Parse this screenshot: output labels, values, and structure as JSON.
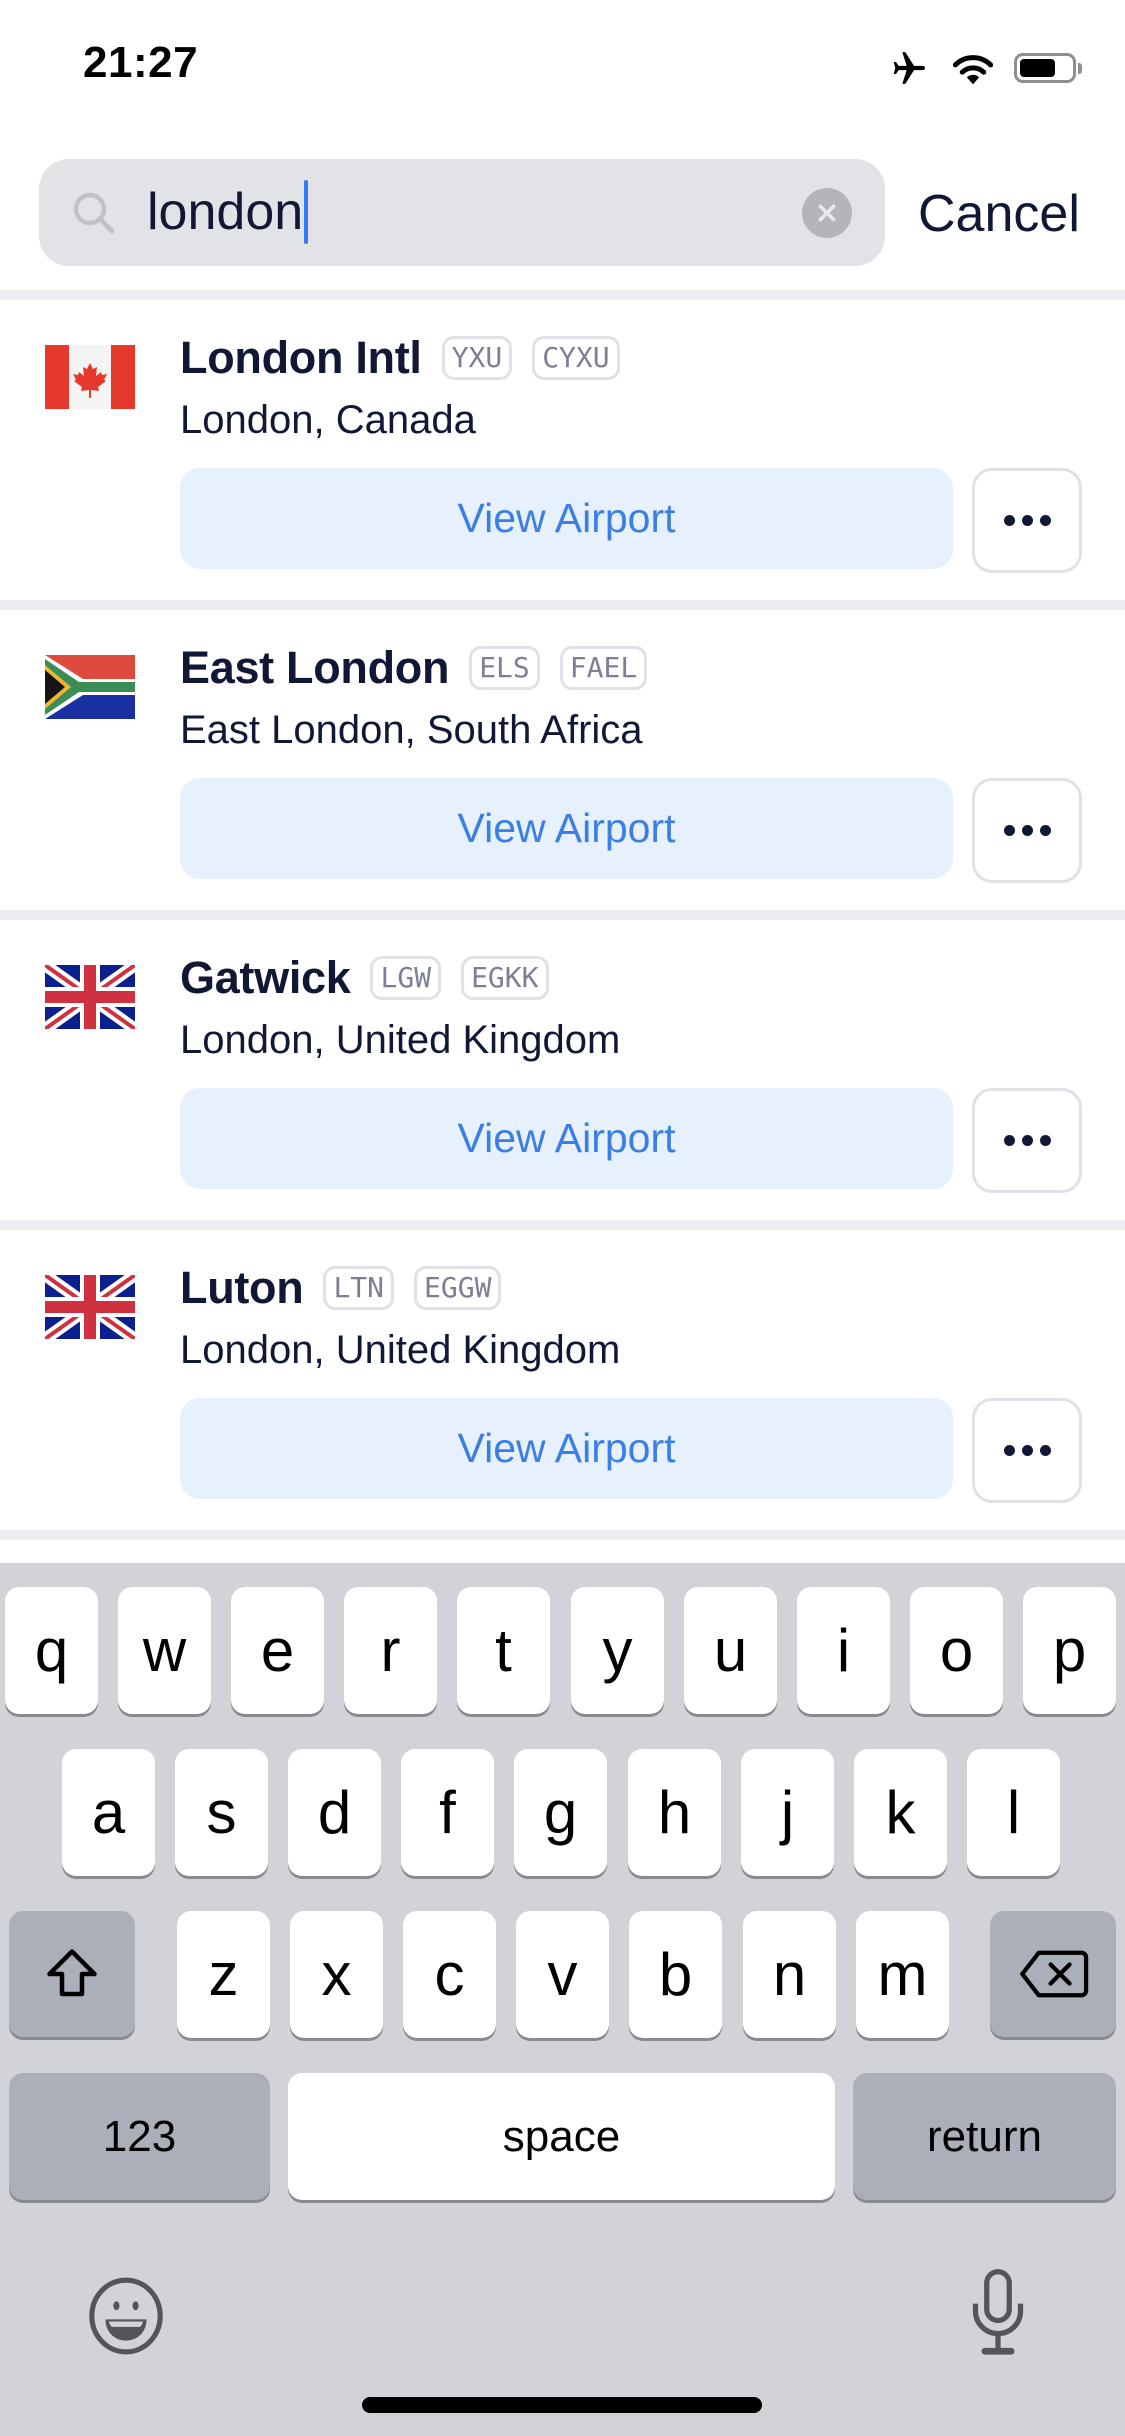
{
  "status_bar": {
    "time": "21:27",
    "icons": [
      "airplane-mode-icon",
      "wifi-icon",
      "battery-icon"
    ],
    "battery_level": 0.7
  },
  "search": {
    "value": "london",
    "placeholder": "",
    "cancel_label": "Cancel"
  },
  "colors": {
    "accent": "#3b7ee6",
    "button_bg": "#e6f1fd",
    "text_primary": "#111836",
    "badge_text": "#7d8094",
    "keyboard_bg": "#d1d3d9"
  },
  "results": [
    {
      "name": "London Intl",
      "iata": "YXU",
      "icao": "CYXU",
      "location": "London, Canada",
      "flag": "canada-flag-icon",
      "action_label": "View Airport",
      "more_label": "More options"
    },
    {
      "name": "East London",
      "iata": "ELS",
      "icao": "FAEL",
      "location": "East London, South Africa",
      "flag": "south-africa-flag-icon",
      "action_label": "View Airport",
      "more_label": "More options"
    },
    {
      "name": "Gatwick",
      "iata": "LGW",
      "icao": "EGKK",
      "location": "London, United Kingdom",
      "flag": "uk-flag-icon",
      "action_label": "View Airport",
      "more_label": "More options"
    },
    {
      "name": "Luton",
      "iata": "LTN",
      "icao": "EGGW",
      "location": "London, United Kingdom",
      "flag": "uk-flag-icon",
      "action_label": "View Airport",
      "more_label": "More options"
    }
  ],
  "keyboard": {
    "row1": [
      "q",
      "w",
      "e",
      "r",
      "t",
      "y",
      "u",
      "i",
      "o",
      "p"
    ],
    "row2": [
      "a",
      "s",
      "d",
      "f",
      "g",
      "h",
      "j",
      "k",
      "l"
    ],
    "row3": [
      "z",
      "x",
      "c",
      "v",
      "b",
      "n",
      "m"
    ],
    "numbers_label": "123",
    "space_label": "space",
    "return_label": "return"
  }
}
